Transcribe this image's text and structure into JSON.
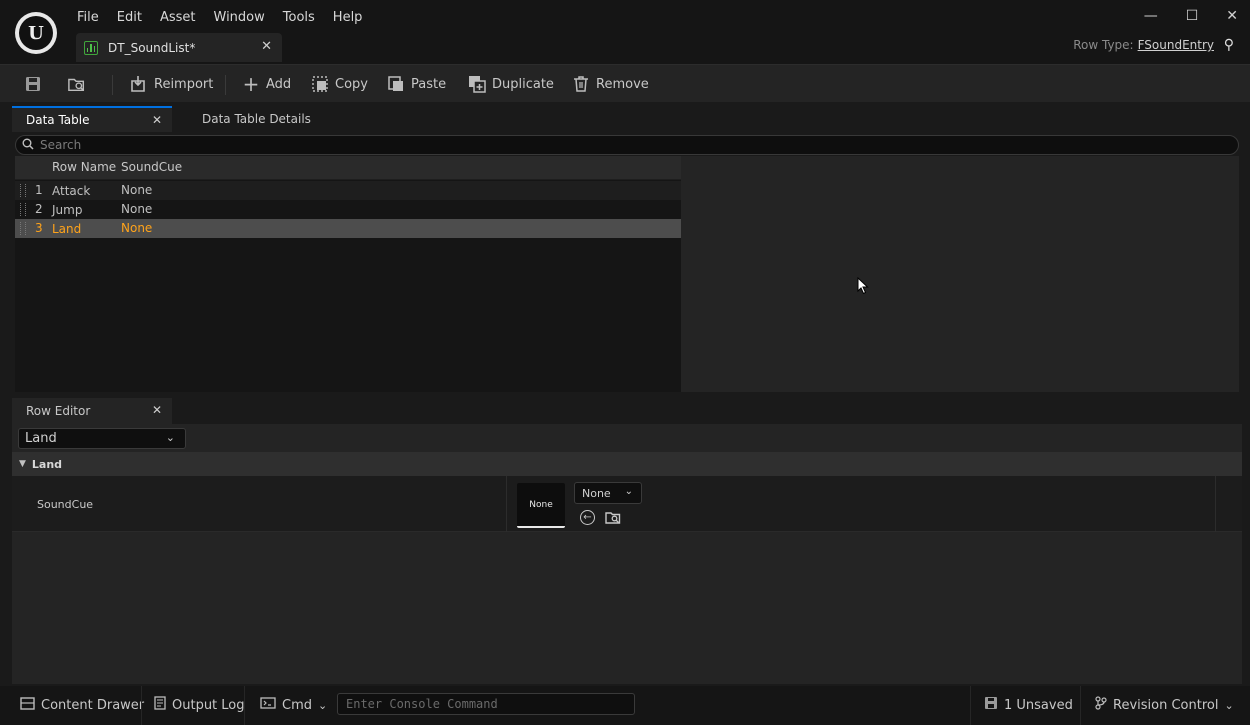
{
  "menu": [
    "File",
    "Edit",
    "Asset",
    "Window",
    "Tools",
    "Help"
  ],
  "document_tab": {
    "title": "DT_SoundList*"
  },
  "row_type": {
    "label": "Row Type:",
    "value": "FSoundEntry"
  },
  "toolbar": {
    "reimport": "Reimport",
    "add": "Add",
    "copy": "Copy",
    "paste": "Paste",
    "duplicate": "Duplicate",
    "remove": "Remove"
  },
  "panels": {
    "data_table_tab": "Data Table",
    "data_table_details_tab": "Data Table Details",
    "row_editor_tab": "Row Editor"
  },
  "search": {
    "placeholder": "Search"
  },
  "table": {
    "columns": [
      "Row Name",
      "SoundCue"
    ],
    "rows": [
      {
        "index": "1",
        "name": "Attack",
        "soundcue": "None"
      },
      {
        "index": "2",
        "name": "Jump",
        "soundcue": "None"
      },
      {
        "index": "3",
        "name": "Land",
        "soundcue": "None",
        "selected": true
      }
    ]
  },
  "row_editor": {
    "selected_row": "Land",
    "category": "Land",
    "property_name": "SoundCue",
    "thumbnail_label": "None",
    "asset_value": "None"
  },
  "statusbar": {
    "content_drawer": "Content Drawer",
    "output_log": "Output Log",
    "cmd": "Cmd",
    "console_placeholder": "Enter Console Command",
    "unsaved": "1 Unsaved",
    "revision_control": "Revision Control"
  },
  "colors": {
    "selection_text": "#ffa31a",
    "tab_accent": "#0070e0",
    "datatable_icon": "#4ec24a"
  }
}
